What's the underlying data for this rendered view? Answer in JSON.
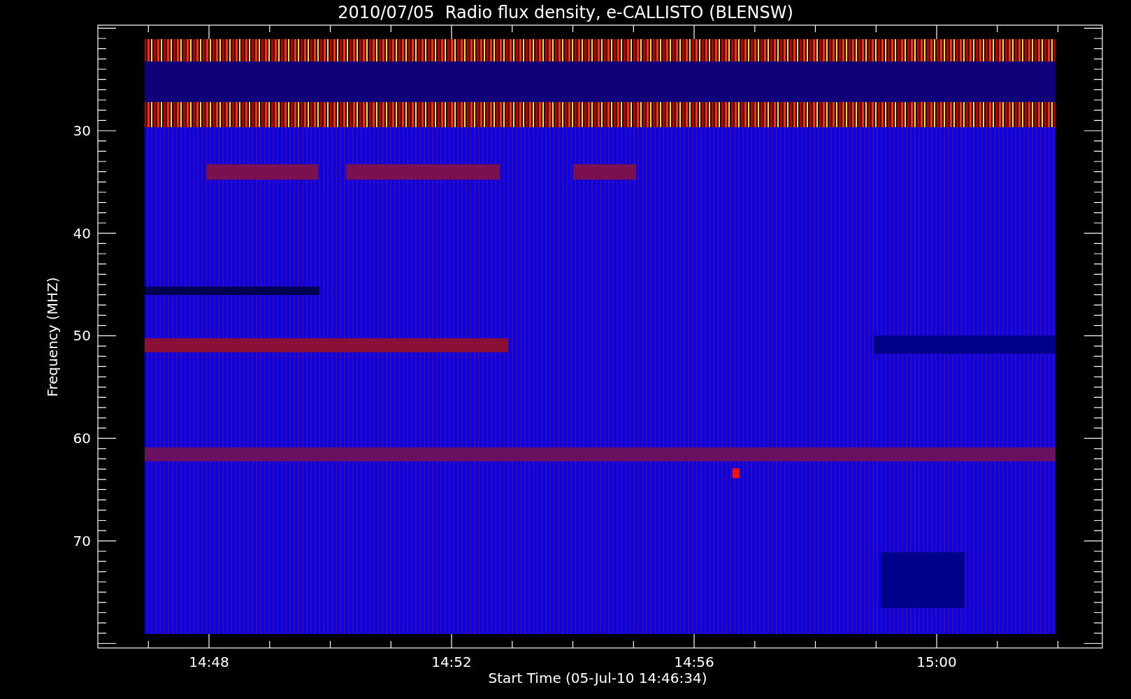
{
  "title": "2010/07/05  Radio flux density, e-CALLISTO (BLENSW)",
  "y_axis": {
    "label": "Frequency (MHZ)",
    "ticks": [
      "30",
      "40",
      "50",
      "60",
      "70"
    ]
  },
  "x_axis": {
    "label": "Start Time (05-Jul-10 14:46:34)",
    "ticks": [
      "14:48",
      "14:52",
      "14:56",
      "15:00"
    ]
  }
}
